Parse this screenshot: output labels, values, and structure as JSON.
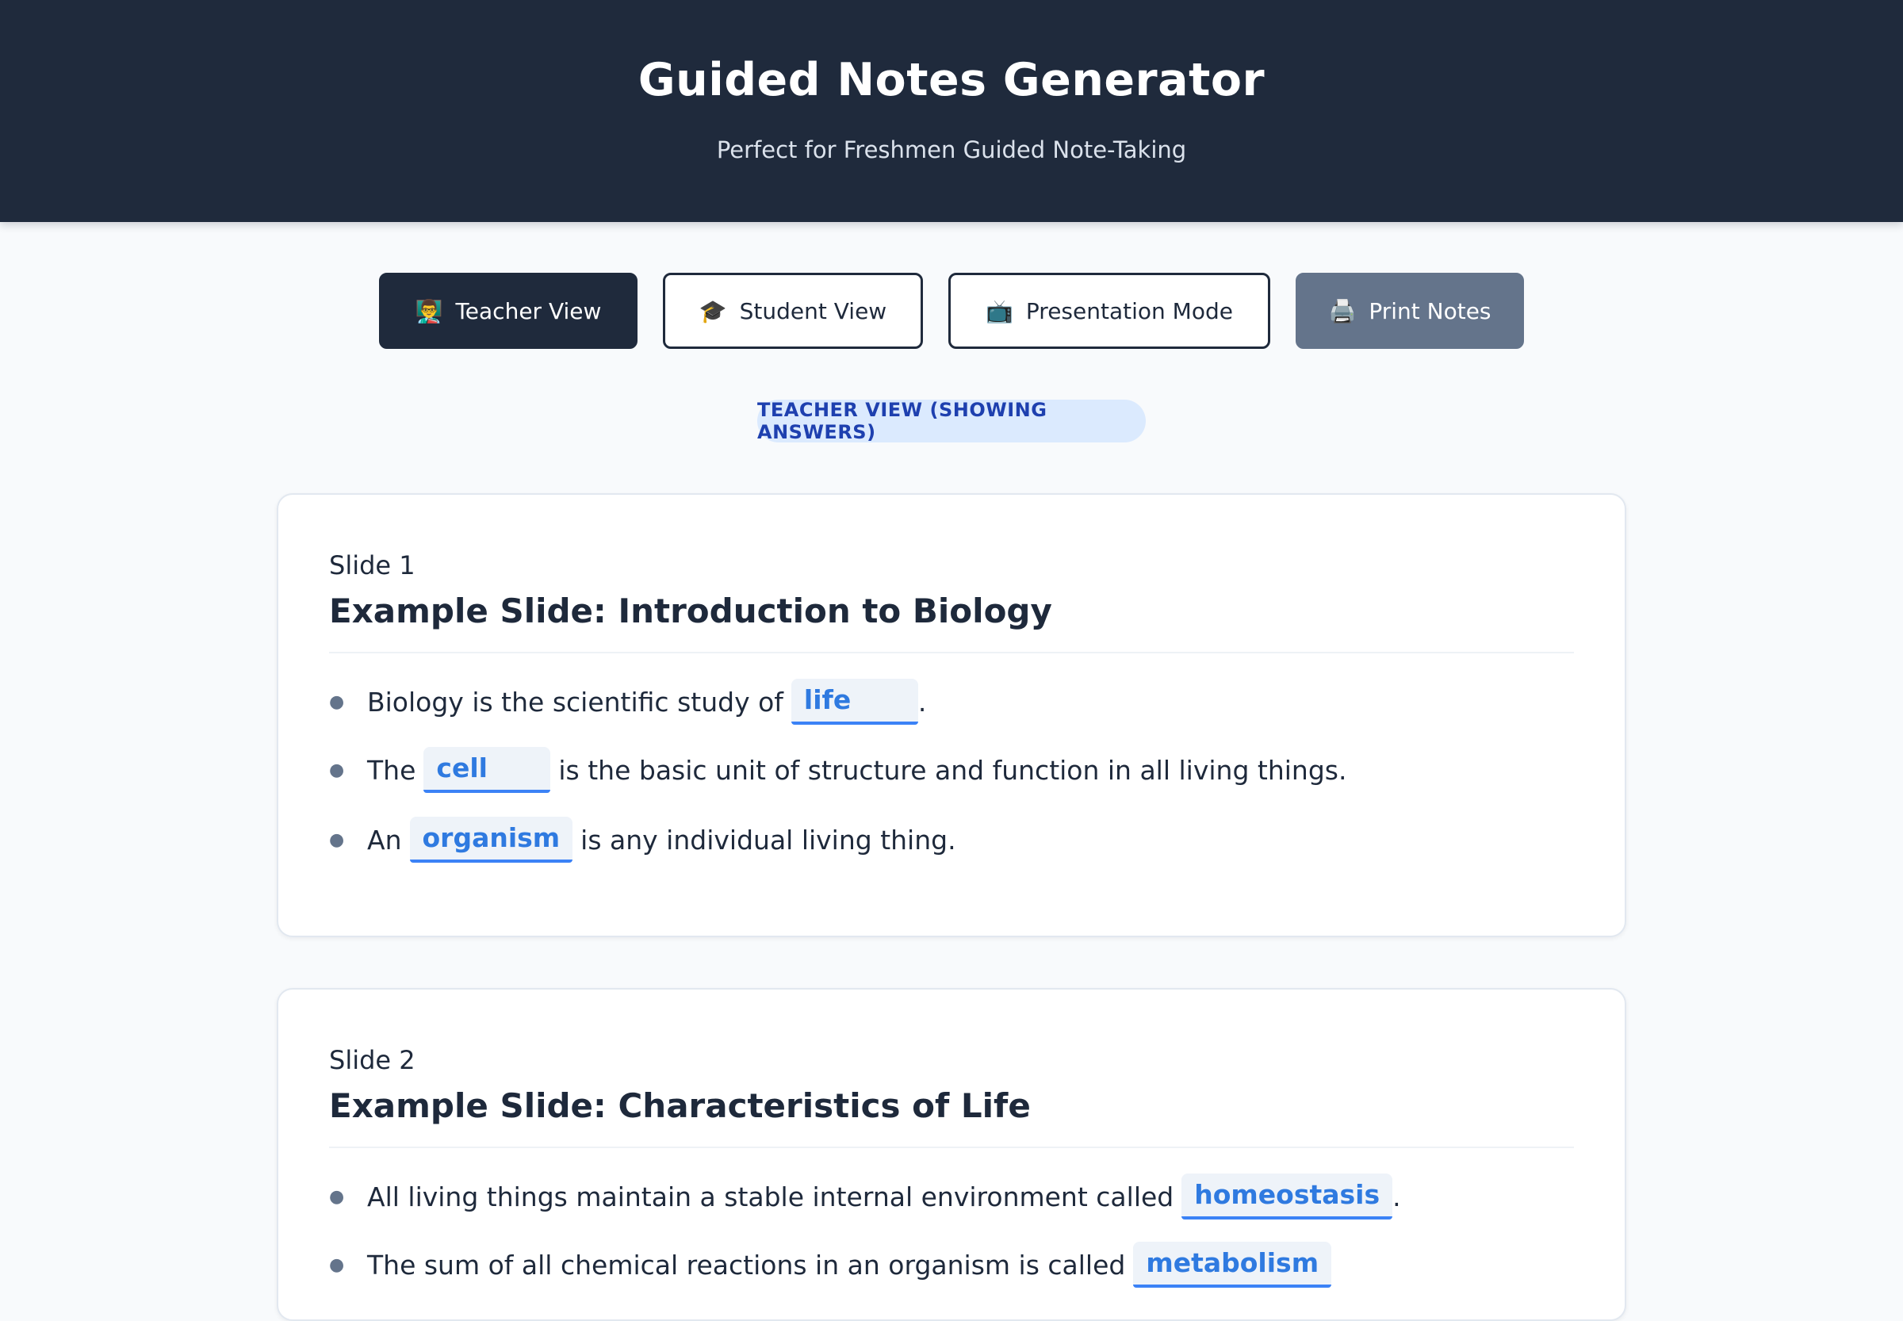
{
  "header": {
    "title": "Guided Notes Generator",
    "subtitle": "Perfect for Freshmen Guided Note-Taking"
  },
  "toolbar": {
    "teacher_icon": "👨‍🏫",
    "teacher_label": "Teacher View",
    "student_icon": "🎓",
    "student_label": "Student View",
    "presentation_icon": "📺",
    "presentation_label": "Presentation Mode",
    "print_icon": "🖨️",
    "print_label": "Print Notes"
  },
  "view_badge": "TEACHER VIEW (SHOWING ANSWERS)",
  "colors": {
    "header_bg": "#1f2a3c",
    "accent": "#3b82f6",
    "badge_bg": "#dbeafe",
    "print_button": "#64748b"
  },
  "slides": [
    {
      "number": "Slide 1",
      "title": "Example Slide: Introduction to Biology",
      "bullets": [
        {
          "before": "Biology is the scientific study of",
          "answer": "life",
          "after": "."
        },
        {
          "before": "The",
          "answer": "cell",
          "after": "is the basic unit of structure and function in all living things."
        },
        {
          "before": "An",
          "answer": "organism",
          "after": "is any individual living thing."
        }
      ]
    },
    {
      "number": "Slide 2",
      "title": "Example Slide: Characteristics of Life",
      "bullets": [
        {
          "before": "All living things maintain a stable internal environment called",
          "answer": "homeostasis",
          "after": "."
        },
        {
          "before": "The sum of all chemical reactions in an organism is called",
          "answer": "metabolism",
          "after": ""
        }
      ]
    }
  ]
}
